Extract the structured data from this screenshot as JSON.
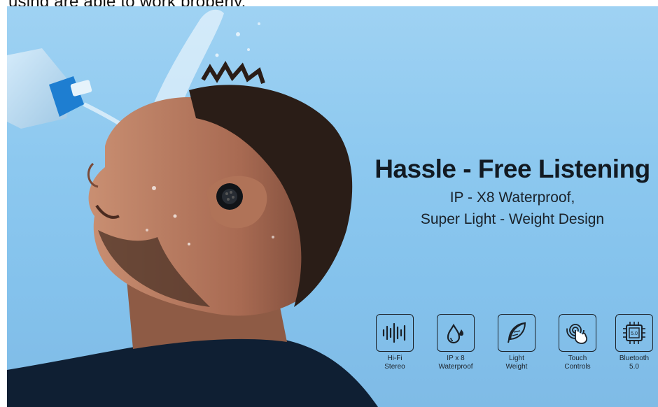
{
  "caption_cut": "using are able to work properly.",
  "banner": {
    "headline": "Hassle - Free Listening",
    "sub_line1": "IP - X8 Waterproof,",
    "sub_line2": "Super Light - Weight Design"
  },
  "features": [
    {
      "icon": "sound-wave-icon",
      "line1": "Hi-Fi",
      "line2": "Stereo"
    },
    {
      "icon": "water-drop-icon",
      "line1": "IP x 8",
      "line2": "Waterproof"
    },
    {
      "icon": "feather-icon",
      "line1": "Light",
      "line2": "Weight"
    },
    {
      "icon": "touch-hand-icon",
      "line1": "Touch",
      "line2": "Controls"
    },
    {
      "icon": "bluetooth-chip-icon",
      "line1": "Bluetooth",
      "line2": "5.0",
      "chip_text": "5.0"
    }
  ]
}
